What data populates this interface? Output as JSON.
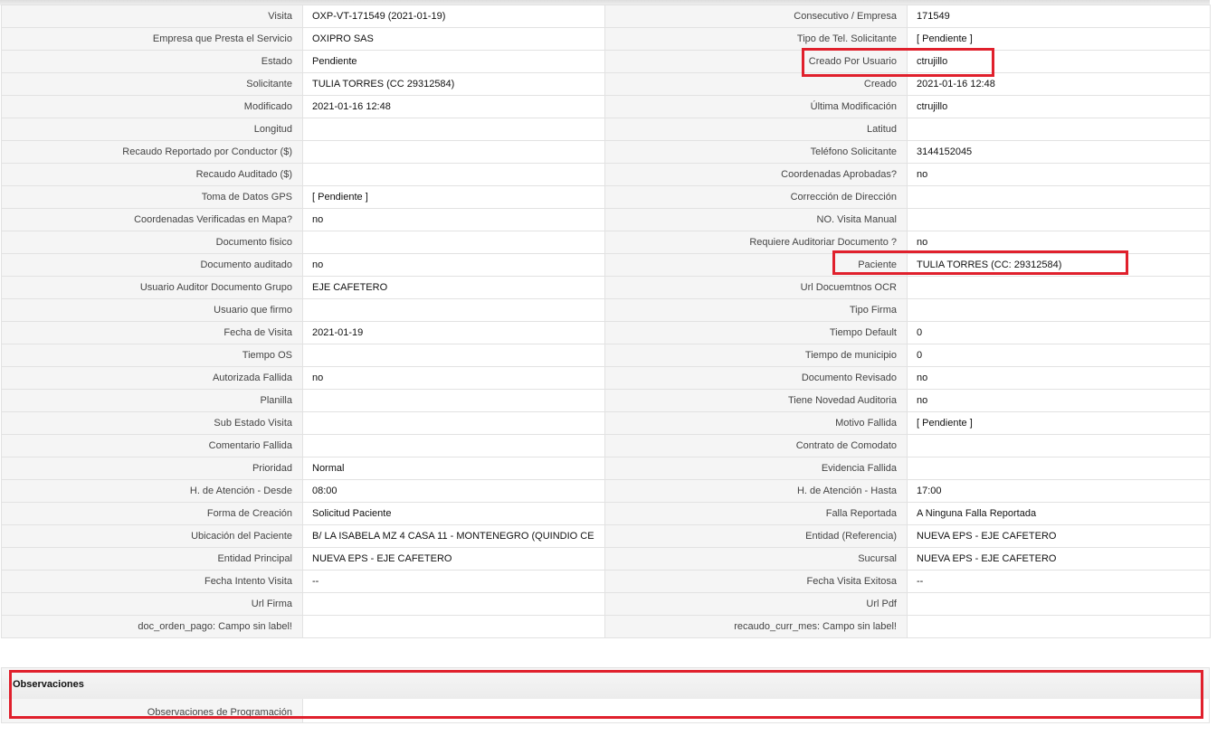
{
  "rows": [
    {
      "l1": "Visita",
      "v1": "OXP-VT-171549 (2021-01-19)",
      "l2": "Consecutivo / Empresa",
      "v2": "171549"
    },
    {
      "l1": "Empresa que Presta el Servicio",
      "v1": "OXIPRO SAS",
      "l2": "Tipo de Tel. Solicitante",
      "v2": "[ Pendiente ]"
    },
    {
      "l1": "Estado",
      "v1": "Pendiente",
      "l2": "Creado Por Usuario",
      "v2": "ctrujillo"
    },
    {
      "l1": "Solicitante",
      "v1": "TULIA TORRES (CC 29312584)",
      "l2": "Creado",
      "v2": "2021-01-16 12:48"
    },
    {
      "l1": "Modificado",
      "v1": "2021-01-16 12:48",
      "l2": "Última Modificación",
      "v2": " ctrujillo"
    },
    {
      "l1": "Longitud",
      "v1": "",
      "l2": "Latitud",
      "v2": ""
    },
    {
      "l1": "Recaudo Reportado por Conductor ($)",
      "v1": "",
      "l2": "Teléfono Solicitante",
      "v2": "3144152045"
    },
    {
      "l1": "Recaudo Auditado ($)",
      "v1": "",
      "l2": "Coordenadas Aprobadas?",
      "v2": " no"
    },
    {
      "l1": "Toma de Datos GPS",
      "v1": "[ Pendiente ]",
      "l2": "Corrección de Dirección",
      "v2": ""
    },
    {
      "l1": "Coordenadas Verificadas en Mapa?",
      "v1": " no",
      "l2": "NO. Visita Manual",
      "v2": ""
    },
    {
      "l1": "Documento fisico",
      "v1": "",
      "l2": "Requiere Auditoriar Documento ?",
      "v2": " no"
    },
    {
      "l1": "Documento auditado",
      "v1": " no",
      "l2": "Paciente",
      "v2": "TULIA TORRES (CC: 29312584)"
    },
    {
      "l1": "Usuario Auditor Documento Grupo",
      "v1": "EJE CAFETERO",
      "l2": "Url Docuemtnos OCR",
      "v2": ""
    },
    {
      "l1": "Usuario que firmo",
      "v1": "",
      "l2": "Tipo Firma",
      "v2": ""
    },
    {
      "l1": "Fecha de Visita",
      "v1": " 2021-01-19",
      "l2": "Tiempo Default",
      "v2": "0"
    },
    {
      "l1": "Tiempo OS",
      "v1": "",
      "l2": "Tiempo de municipio",
      "v2": "0"
    },
    {
      "l1": "Autorizada Fallida",
      "v1": " no",
      "l2": "Documento Revisado",
      "v2": " no"
    },
    {
      "l1": "Planilla",
      "v1": "",
      "l2": "Tiene Novedad Auditoria",
      "v2": " no"
    },
    {
      "l1": "Sub Estado Visita",
      "v1": "",
      "l2": "Motivo Fallida",
      "v2": "[ Pendiente ]"
    },
    {
      "l1": "Comentario Fallida",
      "v1": "",
      "l2": "Contrato de Comodato",
      "v2": ""
    },
    {
      "l1": "Prioridad",
      "v1": "Normal",
      "l2": "Evidencia Fallida",
      "v2": ""
    },
    {
      "l1": "H. de Atención - Desde",
      "v1": "08:00",
      "l2": "H. de Atención - Hasta",
      "v2": "17:00"
    },
    {
      "l1": "Forma de Creación",
      "v1": "Solicitud Paciente",
      "l2": "Falla Reportada",
      "v2": "A Ninguna Falla Reportada"
    },
    {
      "l1": "Ubicación del Paciente",
      "v1": "B/ LA ISABELA MZ 4 CASA 11 - MONTENEGRO (QUINDIO CE",
      "l2": "Entidad (Referencia)",
      "v2": "NUEVA EPS - EJE CAFETERO"
    },
    {
      "l1": "Entidad Principal",
      "v1": "NUEVA EPS - EJE CAFETERO",
      "l2": "Sucursal",
      "v2": "NUEVA EPS - EJE CAFETERO"
    },
    {
      "l1": "Fecha Intento Visita",
      "v1": " --",
      "l2": "Fecha Visita Exitosa",
      "v2": " --"
    },
    {
      "l1": "Url Firma",
      "v1": "",
      "l2": "Url Pdf",
      "v2": ""
    },
    {
      "l1": "doc_orden_pago: Campo sin label!",
      "v1": "",
      "l2": "recaudo_curr_mes: Campo sin label!",
      "v2": ""
    }
  ],
  "observaciones": {
    "title": "Observaciones",
    "label": "Observaciones de Programación",
    "value": ""
  },
  "highlight_color": "#e0202c"
}
